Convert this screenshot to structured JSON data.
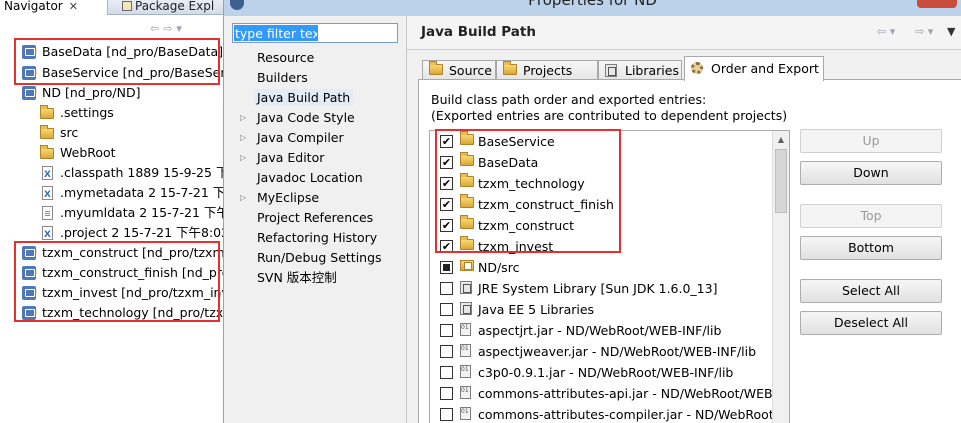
{
  "navigator": {
    "tabs": [
      {
        "label": "Navigator",
        "close": "✕"
      },
      {
        "label": "Package Expl"
      }
    ],
    "toolbar_glyphs": "⇦⇨▾",
    "items": [
      {
        "label": "BaseData [nd_pro/BaseData]",
        "icon": "project-icon"
      },
      {
        "label": "BaseService [nd_pro/BaseServ",
        "icon": "project-icon"
      },
      {
        "label": "ND [nd_pro/ND]",
        "icon": "project-icon"
      },
      {
        "label": ".settings",
        "icon": "folder-icon"
      },
      {
        "label": "src",
        "icon": "folder-icon"
      },
      {
        "label": "WebRoot",
        "icon": "folder-icon"
      },
      {
        "label": ".classpath 1889  15-9-25 下",
        "icon": "xml-file-icon"
      },
      {
        "label": ".mymetadata 2  15-7-21 下",
        "icon": "xml-file-icon"
      },
      {
        "label": ".myumldata 2  15-7-21 下午",
        "icon": "file-icon"
      },
      {
        "label": ".project 2  15-7-21 下午8:02",
        "icon": "xml-file-icon"
      },
      {
        "label": "tzxm_construct [nd_pro/tzxm_",
        "icon": "project-icon"
      },
      {
        "label": "tzxm_construct_finish [nd_pro/",
        "icon": "project-icon"
      },
      {
        "label": "tzxm_invest [nd_pro/tzxm_inve",
        "icon": "project-icon"
      },
      {
        "label": "tzxm_technology [nd_pro/tzxn",
        "icon": "project-icon"
      }
    ]
  },
  "dialog": {
    "title": "Properties for ND",
    "filter": {
      "value": "type filter text"
    },
    "categories": [
      {
        "label": "Resource",
        "expandable": false
      },
      {
        "label": "Builders",
        "expandable": false
      },
      {
        "label": "Java Build Path",
        "expandable": false,
        "selected": true
      },
      {
        "label": "Java Code Style",
        "expandable": true
      },
      {
        "label": "Java Compiler",
        "expandable": true
      },
      {
        "label": "Java Editor",
        "expandable": true
      },
      {
        "label": "Javadoc Location",
        "expandable": false
      },
      {
        "label": "MyEclipse",
        "expandable": true
      },
      {
        "label": "Project References",
        "expandable": false
      },
      {
        "label": "Refactoring History",
        "expandable": false
      },
      {
        "label": "Run/Debug Settings",
        "expandable": false
      },
      {
        "label": "SVN 版本控制",
        "expandable": false
      }
    ],
    "page_title": "Java Build Path",
    "history_glyphs": {
      "back": "⇦ ▾",
      "forward": "⇨ ▾",
      "menu": "▼"
    },
    "tabs": [
      {
        "label": "Source",
        "active": false
      },
      {
        "label": "Projects",
        "active": false
      },
      {
        "label": "Libraries",
        "active": false
      },
      {
        "label": "Order and Export",
        "active": true
      }
    ],
    "description_line1": "Build class path order and exported entries:",
    "description_line2": "(Exported entries are contributed to dependent projects)",
    "entries": [
      {
        "label": "BaseService",
        "state": "checked",
        "icon": "project-folder-icon"
      },
      {
        "label": "BaseData",
        "state": "checked",
        "icon": "project-folder-icon"
      },
      {
        "label": "tzxm_technology",
        "state": "checked",
        "icon": "project-folder-icon"
      },
      {
        "label": "tzxm_construct_finish",
        "state": "checked",
        "icon": "project-folder-icon"
      },
      {
        "label": "tzxm_construct",
        "state": "checked",
        "icon": "project-folder-icon"
      },
      {
        "label": "tzxm_invest",
        "state": "checked",
        "icon": "project-folder-icon"
      },
      {
        "label": "ND/src",
        "state": "partial",
        "icon": "source-folder-icon"
      },
      {
        "label": "JRE System Library [Sun JDK 1.6.0_13]",
        "state": "unchecked",
        "icon": "library-icon"
      },
      {
        "label": "Java EE 5 Libraries",
        "state": "unchecked",
        "icon": "library-icon"
      },
      {
        "label": "aspectjrt.jar - ND/WebRoot/WEB-INF/lib",
        "state": "unchecked",
        "icon": "jar-icon"
      },
      {
        "label": "aspectjweaver.jar - ND/WebRoot/WEB-INF/lib",
        "state": "unchecked",
        "icon": "jar-icon"
      },
      {
        "label": "c3p0-0.9.1.jar - ND/WebRoot/WEB-INF/lib",
        "state": "unchecked",
        "icon": "jar-icon"
      },
      {
        "label": "commons-attributes-api.jar - ND/WebRoot/WEB-IN",
        "state": "unchecked",
        "icon": "jar-icon"
      },
      {
        "label": "commons-attributes-compiler.jar - ND/WebRoot/W",
        "state": "unchecked",
        "icon": "jar-icon"
      }
    ],
    "buttons": {
      "up": "Up",
      "down": "Down",
      "top": "Top",
      "bottom": "Bottom",
      "select_all": "Select All",
      "deselect_all": "Deselect All"
    }
  },
  "colors": {
    "highlight": "#e53030",
    "selection": "#3399ff",
    "titlebar": "#bcd2ea"
  }
}
